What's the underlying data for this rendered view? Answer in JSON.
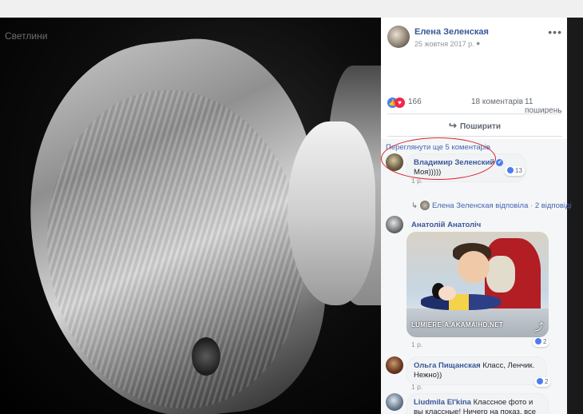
{
  "photo": {
    "header_text": "Светлини"
  },
  "post": {
    "author": "Елена Зеленская",
    "date": "25 жовтня 2017 р.",
    "privacy_icon": "globe-icon",
    "more_icon": "more-horizontal-icon",
    "more_label": "•••"
  },
  "reactions": {
    "like_icon": "like-icon",
    "love_icon": "love-icon",
    "count": "166",
    "comments": "18 коментарів",
    "shares": "11 поширень"
  },
  "actions": {
    "share_label": "Поширити",
    "share_icon": "share-arrow-icon",
    "share_glyph": "↪"
  },
  "comments": {
    "view_more": "Переглянути ще 5 коментарів",
    "items": [
      {
        "name": "Владимир Зеленский",
        "verified": "✔",
        "text": "Моя)))))",
        "time": "1 р.",
        "likes": "13"
      },
      {
        "reply_prefix": "↳",
        "reply_author": "Елена Зеленская відповіла",
        "reply_sep": "·",
        "reply_count": "2 відповіді"
      },
      {
        "name": "Анатолій Анатоліч",
        "gif_caption": "LUMIERE-A.AKAMAIHD.NET",
        "gif_share_glyph": "⤴",
        "time": "1 р.",
        "likes": "2"
      },
      {
        "name": "Ольга Пищанская",
        "text": "Класс, Ленчик. Нежно))",
        "time": "1 р.",
        "likes": "2"
      },
      {
        "name": "Liudmila El'kina",
        "text": "Классное фото и вы классные! Ничего на показ, все искренне!"
      }
    ]
  },
  "colors": {
    "link_blue": "#385898",
    "highlight_red": "#d8232a",
    "like_blue": "#4a7df0",
    "love_red": "#f0284a"
  }
}
